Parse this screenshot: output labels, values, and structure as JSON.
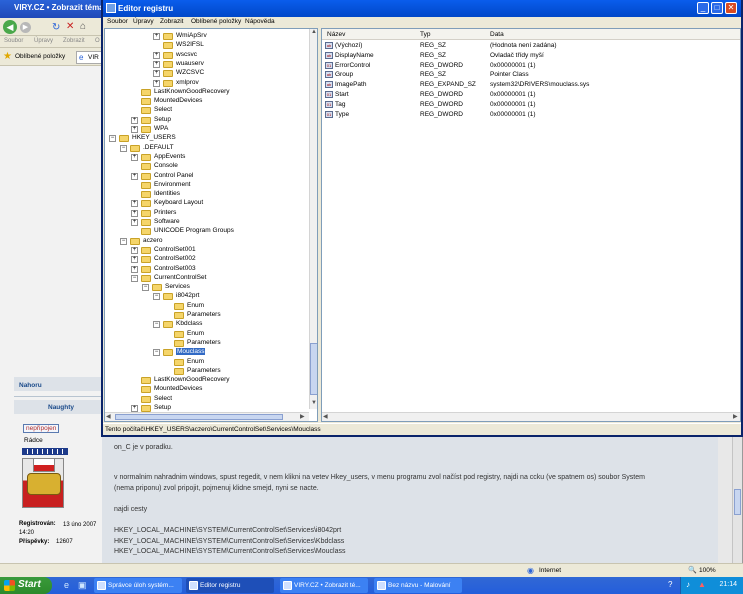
{
  "background_browser": {
    "title": "VIRY.CZ • Zobrazit téma",
    "menu": [
      "Soubor",
      "Úpravy",
      "Zobrazit",
      "O"
    ],
    "favorites_label": "Oblíbené položky",
    "tab_fragment": "VIR",
    "forum": {
      "top_link": "Nahoru",
      "user_name": "Naughty",
      "user_status": "nepřipojen",
      "rank": "Rádce",
      "registered_label": "Registrován:",
      "registered_value": "13 úno 2007 14:20",
      "posts_label": "Příspěvky:",
      "posts_value": "12607",
      "post_lines": [
        "on_C je v poradku.",
        "v normalnim nahradnim windows, spust regedit, v nem klikni na vetev Hkey_users, v menu programu zvol načíst pod registry, najdi na ccku (ve spatnem os) soubor System",
        "(nema priponu) zvol pripojit, pojmenuj klidne smejd, nyni se nacte.",
        "najdi cesty",
        "HKEY_LOCAL_MACHINE\\SYSTEM\\CurrentControlSet\\Services\\i8042prt",
        "HKEY_LOCAL_MACHINE\\SYSTEM\\CurrentControlSet\\Services\\Kbdclass",
        "HKEY_LOCAL_MACHINE\\SYSTEM\\CurrentControlSet\\Services\\Mouclass"
      ]
    },
    "status_zone": "Internet",
    "zoom": "100%"
  },
  "regedit": {
    "title": "Editor registru",
    "menu": [
      "Soubor",
      "Úpravy",
      "Zobrazit",
      "Oblíbené položky",
      "Nápověda"
    ],
    "tree": [
      {
        "label": "WmiApSrv",
        "level": 5,
        "pm": "+"
      },
      {
        "label": "WS2IFSL",
        "level": 5,
        "pm": ""
      },
      {
        "label": "wscsvc",
        "level": 5,
        "pm": "+"
      },
      {
        "label": "wuauserv",
        "level": 5,
        "pm": "+"
      },
      {
        "label": "WZCSVC",
        "level": 5,
        "pm": "+"
      },
      {
        "label": "xmlprov",
        "level": 5,
        "pm": "+"
      },
      {
        "label": "LastKnownGoodRecovery",
        "level": 3,
        "pm": ""
      },
      {
        "label": "MountedDevices",
        "level": 3,
        "pm": ""
      },
      {
        "label": "Select",
        "level": 3,
        "pm": ""
      },
      {
        "label": "Setup",
        "level": 3,
        "pm": "+"
      },
      {
        "label": "WPA",
        "level": 3,
        "pm": "+"
      },
      {
        "label": "HKEY_USERS",
        "level": 1,
        "pm": "−"
      },
      {
        "label": ".DEFAULT",
        "level": 2,
        "pm": "−"
      },
      {
        "label": "AppEvents",
        "level": 3,
        "pm": "+"
      },
      {
        "label": "Console",
        "level": 3,
        "pm": ""
      },
      {
        "label": "Control Panel",
        "level": 3,
        "pm": "+"
      },
      {
        "label": "Environment",
        "level": 3,
        "pm": ""
      },
      {
        "label": "Identities",
        "level": 3,
        "pm": ""
      },
      {
        "label": "Keyboard Layout",
        "level": 3,
        "pm": "+"
      },
      {
        "label": "Printers",
        "level": 3,
        "pm": "+"
      },
      {
        "label": "Software",
        "level": 3,
        "pm": "+"
      },
      {
        "label": "UNICODE Program Groups",
        "level": 3,
        "pm": ""
      },
      {
        "label": "aczero",
        "level": 2,
        "pm": "−"
      },
      {
        "label": "ControlSet001",
        "level": 3,
        "pm": "+"
      },
      {
        "label": "ControlSet002",
        "level": 3,
        "pm": "+"
      },
      {
        "label": "ControlSet003",
        "level": 3,
        "pm": "+"
      },
      {
        "label": "CurrentControlSet",
        "level": 3,
        "pm": "−"
      },
      {
        "label": "Services",
        "level": 4,
        "pm": "−"
      },
      {
        "label": "i8042prt",
        "level": 5,
        "pm": "−"
      },
      {
        "label": "Enum",
        "level": 6,
        "pm": ""
      },
      {
        "label": "Parameters",
        "level": 6,
        "pm": ""
      },
      {
        "label": "Kbdclass",
        "level": 5,
        "pm": "−"
      },
      {
        "label": "Enum",
        "level": 6,
        "pm": ""
      },
      {
        "label": "Parameters",
        "level": 6,
        "pm": ""
      },
      {
        "label": "Mouclass",
        "level": 5,
        "pm": "−",
        "selected": true
      },
      {
        "label": "Enum",
        "level": 6,
        "pm": ""
      },
      {
        "label": "Parameters",
        "level": 6,
        "pm": ""
      },
      {
        "label": "LastKnownGoodRecovery",
        "level": 3,
        "pm": ""
      },
      {
        "label": "MountedDevices",
        "level": 3,
        "pm": ""
      },
      {
        "label": "Select",
        "level": 3,
        "pm": ""
      },
      {
        "label": "Setup",
        "level": 3,
        "pm": "+"
      }
    ],
    "columns": {
      "name": "Název",
      "type": "Typ",
      "data": "Data"
    },
    "values": [
      {
        "name": "(Výchozí)",
        "type": "REG_SZ",
        "data": "(Hodnota není zadána)",
        "icon": "ab"
      },
      {
        "name": "DisplayName",
        "type": "REG_SZ",
        "data": "Ovladač třídy myší",
        "icon": "ab"
      },
      {
        "name": "ErrorControl",
        "type": "REG_DWORD",
        "data": "0x00000001 (1)",
        "icon": "01"
      },
      {
        "name": "Group",
        "type": "REG_SZ",
        "data": "Pointer Class",
        "icon": "ab"
      },
      {
        "name": "ImagePath",
        "type": "REG_EXPAND_SZ",
        "data": "system32\\DRIVERS\\mouclass.sys",
        "icon": "ab"
      },
      {
        "name": "Start",
        "type": "REG_DWORD",
        "data": "0x00000001 (1)",
        "icon": "01"
      },
      {
        "name": "Tag",
        "type": "REG_DWORD",
        "data": "0x00000001 (1)",
        "icon": "01"
      },
      {
        "name": "Type",
        "type": "REG_DWORD",
        "data": "0x00000001 (1)",
        "icon": "01"
      }
    ],
    "status_path": "Tento počítač\\HKEY_USERS\\aczero\\CurrentControlSet\\Services\\Mouclass"
  },
  "taskbar": {
    "start_label": "Start",
    "buttons": [
      {
        "label": "Správce úloh systém...",
        "active": false
      },
      {
        "label": "Editor registru",
        "active": true
      },
      {
        "label": "VIRY.CZ • Zobrazit té...",
        "active": false
      },
      {
        "label": "Bez názvu - Malování",
        "active": false
      }
    ],
    "clock": "21:14"
  }
}
